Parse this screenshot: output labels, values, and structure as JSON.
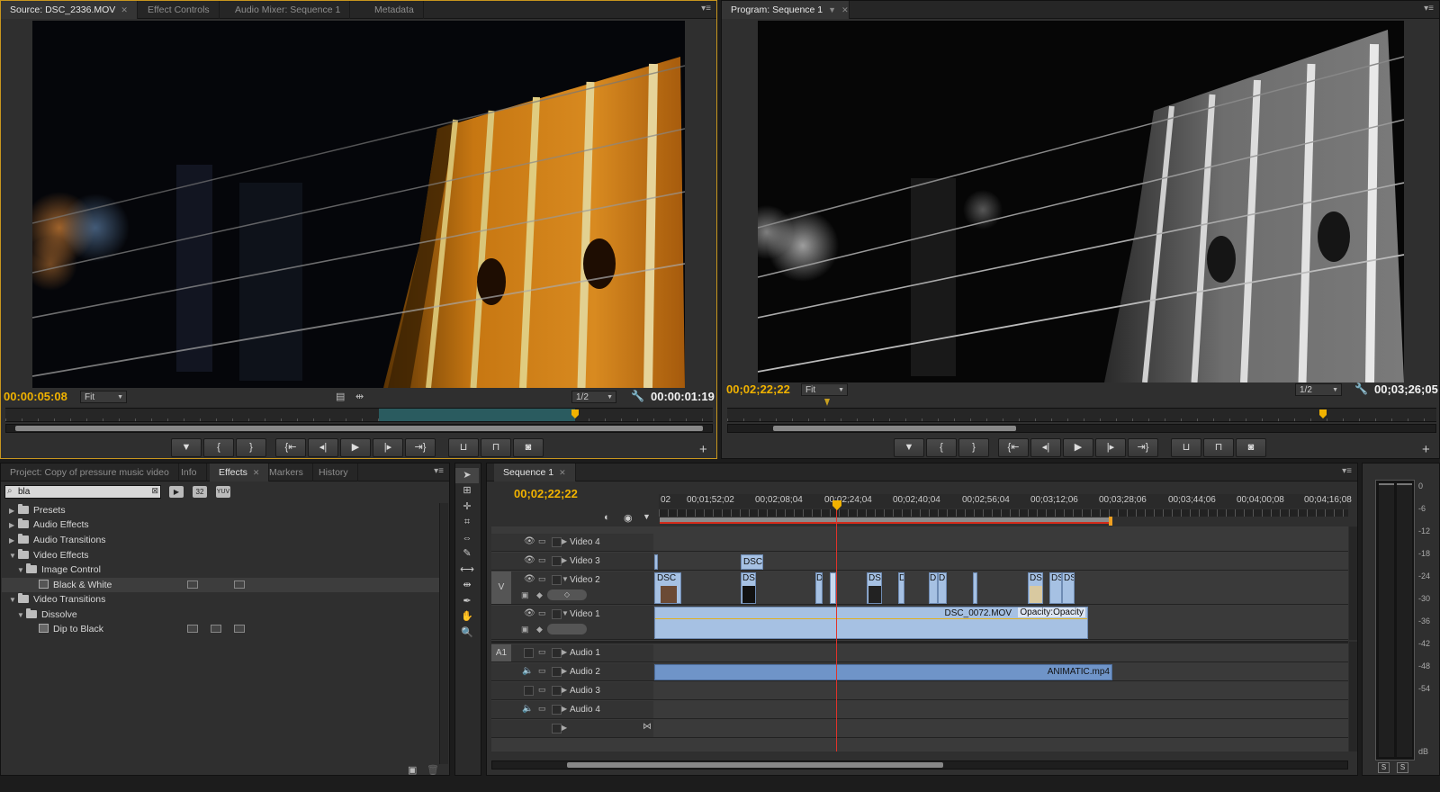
{
  "source_panel": {
    "tabs": [
      {
        "label": "Source: DSC_2336.MOV",
        "active": true
      },
      {
        "label": "Effect Controls"
      },
      {
        "label": "Audio Mixer: Sequence 1"
      },
      {
        "label": "Metadata"
      }
    ],
    "timecode_current": "00:00:05:08",
    "timecode_duration": "00:00:01:19",
    "zoom": "Fit",
    "resolution": "1/2"
  },
  "program_panel": {
    "tab": "Program: Sequence 1",
    "timecode_current": "00;02;22;22",
    "timecode_duration": "00;03;26;05",
    "zoom": "Fit",
    "resolution": "1/2"
  },
  "project_panel": {
    "tabs": [
      {
        "label": "Project: Copy of pressure music video"
      },
      {
        "label": "Info"
      },
      {
        "label": "Effects",
        "active": true
      },
      {
        "label": "Markers"
      },
      {
        "label": "History"
      }
    ],
    "search_value": "bla",
    "tree": [
      {
        "label": "Presets",
        "level": 0,
        "expanded": false
      },
      {
        "label": "Audio Effects",
        "level": 0,
        "expanded": false
      },
      {
        "label": "Audio Transitions",
        "level": 0,
        "expanded": false
      },
      {
        "label": "Video Effects",
        "level": 0,
        "expanded": true
      },
      {
        "label": "Image Control",
        "level": 1,
        "expanded": true
      },
      {
        "label": "Black & White",
        "level": 2,
        "effect": true,
        "selected": true
      },
      {
        "label": "Video Transitions",
        "level": 0,
        "expanded": true
      },
      {
        "label": "Dissolve",
        "level": 1,
        "expanded": true
      },
      {
        "label": "Dip to Black",
        "level": 2,
        "effect": true
      }
    ],
    "badge_labels": [
      "32",
      "YUV"
    ]
  },
  "timeline": {
    "tab": "Sequence 1",
    "timecode": "00;02;22;22",
    "ruler_labels": [
      "02",
      "00;01;52;02",
      "00;02;08;04",
      "00;02;24;04",
      "00;02;40;04",
      "00;02;56;04",
      "00;03;12;06",
      "00;03;28;06",
      "00;03;44;06",
      "00;04;00;08",
      "00;04;16;08"
    ],
    "video_tracks": [
      "Video 4",
      "Video 3",
      "Video 2",
      "Video 1"
    ],
    "audio_tracks": [
      "Audio 1",
      "Audio 2",
      "Audio 3",
      "Audio 4"
    ],
    "target_video": "V",
    "target_audio": "A1",
    "clip_labels": {
      "v3": "DSC",
      "v2_first": "DSC",
      "v2_second": "DS",
      "v2_small": [
        "D",
        "D",
        "D",
        "D",
        "DS",
        "DS",
        "DS"
      ],
      "v1": "DSC_0072.MOV",
      "v1_opacity": "Opacity:Opacity",
      "a2": "ANIMATIC.mp4"
    }
  },
  "audio_meter": {
    "scale": [
      "0",
      "-6",
      "-12",
      "-18",
      "-24",
      "-30",
      "-36",
      "-42",
      "-48",
      "-54",
      "dB"
    ],
    "solo_buttons": [
      "S",
      "S"
    ]
  }
}
